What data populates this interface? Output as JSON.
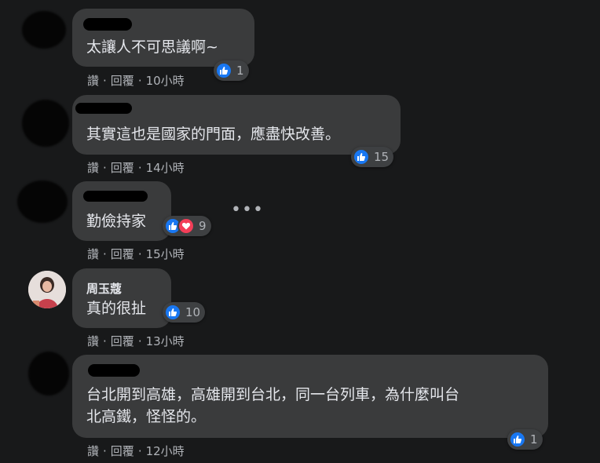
{
  "actions": {
    "like": "讚",
    "reply": "回覆",
    "dot": "·"
  },
  "comments": [
    {
      "author": "",
      "text": "太讓人不可思議啊~",
      "time": "10小時",
      "reactions": [
        "like"
      ],
      "count": "1"
    },
    {
      "author": "",
      "text": "其實這也是國家的門面，應盡快改善。",
      "time": "14小時",
      "reactions": [
        "like"
      ],
      "count": "15"
    },
    {
      "author": "",
      "text": "勤儉持家",
      "time": "15小時",
      "reactions": [
        "like",
        "love"
      ],
      "count": "9"
    },
    {
      "author": "周玉蔻",
      "text": "真的很扯",
      "time": "13小時",
      "reactions": [
        "like"
      ],
      "count": "10"
    },
    {
      "author": "",
      "text": "台北開到高雄，高雄開到台北，同一台列車，為什麼叫台\n北高鐵，怪怪的。",
      "time": "12小時",
      "reactions": [
        "like"
      ],
      "count": "1"
    }
  ],
  "more_options_icon": "ellipsis-icon",
  "colors": {
    "background": "#18191a",
    "bubble": "#3a3b3c",
    "text": "#e4e6eb",
    "secondary_text": "#b0b3b8",
    "like_blue": "#1877f2",
    "love_red": "#f33e58"
  }
}
